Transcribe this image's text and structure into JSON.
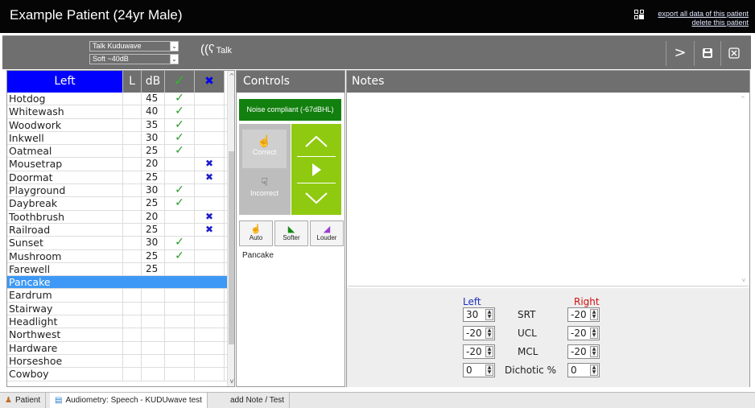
{
  "window": {
    "title": "Example Patient (24yr Male)",
    "links": [
      "export all data of this patient",
      "delete this patient"
    ]
  },
  "toolbar": {
    "talk_select": "Talk Kuduwave",
    "level_select": "Soft ~40dB",
    "talk_label": "Talk",
    "next_icon": "chevron-right-icon",
    "save_icon": "save-icon",
    "close_icon": "close-icon"
  },
  "word_list": {
    "headers": {
      "word": "Left",
      "l": "L",
      "db": "dB",
      "ok": "✓",
      "no": "✖"
    },
    "rows": [
      {
        "word": "Hotdog",
        "db": "45",
        "ok": "✓",
        "no": ""
      },
      {
        "word": "Whitewash",
        "db": "40",
        "ok": "✓",
        "no": ""
      },
      {
        "word": "Woodwork",
        "db": "35",
        "ok": "✓",
        "no": ""
      },
      {
        "word": "Inkwell",
        "db": "30",
        "ok": "✓",
        "no": ""
      },
      {
        "word": "Oatmeal",
        "db": "25",
        "ok": "✓",
        "no": ""
      },
      {
        "word": "Mousetrap",
        "db": "20",
        "ok": "",
        "no": "✖"
      },
      {
        "word": "Doormat",
        "db": "25",
        "ok": "",
        "no": "✖"
      },
      {
        "word": "Playground",
        "db": "30",
        "ok": "✓",
        "no": ""
      },
      {
        "word": "Daybreak",
        "db": "25",
        "ok": "✓",
        "no": ""
      },
      {
        "word": "Toothbrush",
        "db": "20",
        "ok": "",
        "no": "✖"
      },
      {
        "word": "Railroad",
        "db": "25",
        "ok": "",
        "no": "✖"
      },
      {
        "word": "Sunset",
        "db": "30",
        "ok": "✓",
        "no": ""
      },
      {
        "word": "Mushroom",
        "db": "25",
        "ok": "✓",
        "no": ""
      },
      {
        "word": "Farewell",
        "db": "25",
        "ok": "",
        "no": ""
      },
      {
        "word": "Pancake",
        "db": "",
        "ok": "",
        "no": "",
        "selected": true
      },
      {
        "word": "Eardrum",
        "db": "",
        "ok": "",
        "no": ""
      },
      {
        "word": "Stairway",
        "db": "",
        "ok": "",
        "no": ""
      },
      {
        "word": "Headlight",
        "db": "",
        "ok": "",
        "no": ""
      },
      {
        "word": "Northwest",
        "db": "",
        "ok": "",
        "no": ""
      },
      {
        "word": "Hardware",
        "db": "",
        "ok": "",
        "no": ""
      },
      {
        "word": "Horseshoe",
        "db": "",
        "ok": "",
        "no": ""
      },
      {
        "word": "Cowboy",
        "db": "",
        "ok": "",
        "no": ""
      }
    ]
  },
  "controls": {
    "title": "Controls",
    "noise_status": "Noise compliant (-67dBHL)",
    "correct_label": "Correct",
    "incorrect_label": "Incorrect",
    "auto_label": "Auto",
    "softer_label": "Softer",
    "louder_label": "Louder",
    "current_word": "Pancake"
  },
  "notes": {
    "title": "Notes",
    "left_label": "Left",
    "right_label": "Right",
    "measures": [
      {
        "label": "SRT",
        "left": "30",
        "right": "-20"
      },
      {
        "label": "UCL",
        "left": "-20",
        "right": "-20"
      },
      {
        "label": "MCL",
        "left": "-20",
        "right": "-20"
      },
      {
        "label": "Dichotic %",
        "left": "0",
        "right": "0"
      }
    ]
  },
  "status_tabs": [
    "Patient",
    "Audiometry: Speech - KUDUwave test",
    "add Note / Test"
  ],
  "colors": {
    "selected_row": "#3d99f5",
    "header_left": "#0000ff",
    "noise_ok": "#12800f",
    "nav_green": "#8fca10",
    "left_ear": "#1e2fbf",
    "right_ear": "#d01010"
  }
}
